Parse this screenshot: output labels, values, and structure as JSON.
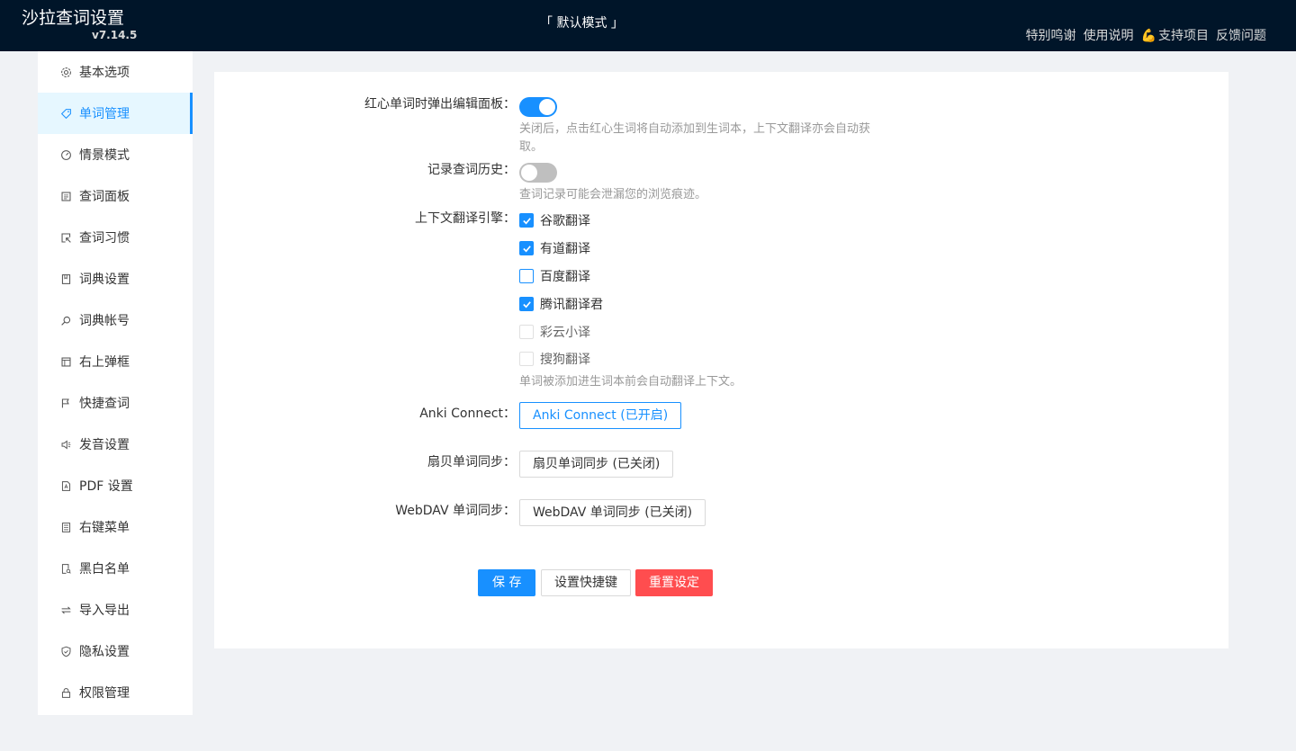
{
  "header": {
    "title": "沙拉查词设置",
    "version": "v7.14.5",
    "mode": "「 默认模式 」",
    "links": [
      "特别鸣谢",
      "使用说明",
      "支持项目",
      "反馈问题"
    ]
  },
  "sidebar": {
    "items": [
      {
        "label": "基本选项",
        "icon": "gear-icon"
      },
      {
        "label": "单词管理",
        "icon": "tag-icon",
        "active": true
      },
      {
        "label": "情景模式",
        "icon": "dashboard-icon"
      },
      {
        "label": "查词面板",
        "icon": "panel-icon"
      },
      {
        "label": "查词习惯",
        "icon": "select-icon"
      },
      {
        "label": "词典设置",
        "icon": "book-icon"
      },
      {
        "label": "词典帐号",
        "icon": "search-icon"
      },
      {
        "label": "右上弹框",
        "icon": "layout-icon"
      },
      {
        "label": "快捷查词",
        "icon": "flag-icon"
      },
      {
        "label": "发音设置",
        "icon": "sound-icon"
      },
      {
        "label": "PDF 设置",
        "icon": "pdf-icon"
      },
      {
        "label": "右键菜单",
        "icon": "list-icon"
      },
      {
        "label": "黑白名单",
        "icon": "audit-icon"
      },
      {
        "label": "导入导出",
        "icon": "swap-icon"
      },
      {
        "label": "隐私设置",
        "icon": "shield-icon"
      },
      {
        "label": "权限管理",
        "icon": "lock-icon"
      }
    ]
  },
  "form": {
    "edit_panel": {
      "label": "红心单词时弹出编辑面板：",
      "enabled": true,
      "help": "关闭后，点击红心生词将自动添加到生词本，上下文翻译亦会自动获取。"
    },
    "history": {
      "label": "记录查词历史：",
      "enabled": false,
      "help": "查词记录可能会泄漏您的浏览痕迹。"
    },
    "ctx_engines": {
      "label": "上下文翻译引擎：",
      "options": [
        {
          "label": "谷歌翻译",
          "state": "checked"
        },
        {
          "label": "有道翻译",
          "state": "checked"
        },
        {
          "label": "百度翻译",
          "state": "unchecked"
        },
        {
          "label": "腾讯翻译君",
          "state": "checked"
        },
        {
          "label": "彩云小译",
          "state": "disabled"
        },
        {
          "label": "搜狗翻译",
          "state": "disabled"
        }
      ],
      "help": "单词被添加进生词本前会自动翻译上下文。"
    },
    "anki": {
      "label": "Anki Connect：",
      "button": "Anki Connect (已开启)"
    },
    "shanbay": {
      "label": "扇贝单词同步：",
      "button": "扇贝单词同步 (已关闭)"
    },
    "webdav": {
      "label": "WebDAV 单词同步：",
      "button": "WebDAV 单词同步 (已关闭)"
    }
  },
  "actions": {
    "save": "保 存",
    "shortcut": "设置快捷键",
    "reset": "重置设定"
  },
  "colors": {
    "header_bg": "#001529",
    "primary": "#1890ff",
    "danger": "#ff4d4f"
  }
}
